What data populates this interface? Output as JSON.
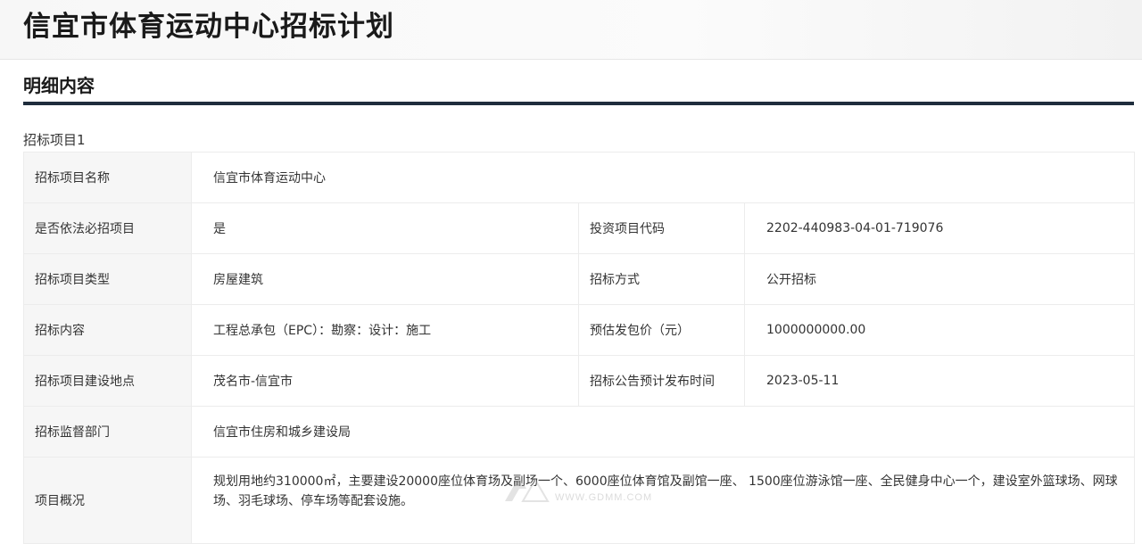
{
  "header": {
    "title": "信宜市体育运动中心招标计划"
  },
  "section": {
    "title": "明细内容"
  },
  "project": {
    "label": "招标项目1",
    "rows": {
      "name": {
        "label": "招标项目名称",
        "value": "信宜市体育运动中心"
      },
      "mandatory": {
        "label": "是否依法必招项目",
        "value": "是"
      },
      "investment_code": {
        "label": "投资项目代码",
        "value": "2202-440983-04-01-719076"
      },
      "type": {
        "label": "招标项目类型",
        "value": "房屋建筑"
      },
      "method": {
        "label": "招标方式",
        "value": "公开招标"
      },
      "content": {
        "label": "招标内容",
        "value": "工程总承包（EPC）：勘察：设计：施工"
      },
      "estimated_price": {
        "label": "预估发包价（元）",
        "value": "1000000000.00"
      },
      "location": {
        "label": "招标项目建设地点",
        "value": "茂名市-信宜市"
      },
      "publish_time": {
        "label": "招标公告预计发布时间",
        "value": "2023-05-11"
      },
      "supervisor": {
        "label": "招标监督部门",
        "value": "信宜市住房和城乡建设局"
      },
      "overview": {
        "label": "项目概况",
        "value": "规划用地约310000㎡，主要建设20000座位体育场及副场一个、6000座位体育馆及副馆一座、 1500座位游泳馆一座、全民健身中心一个，建设室外篮球场、网球场、羽毛球场、停车场等配套设施。"
      }
    }
  },
  "watermark": {
    "text": "WWW.GDMM.COM"
  },
  "colors": {
    "rule": "#1f2d3d",
    "label_bg": "#f6f6f6",
    "border": "#ececec"
  }
}
